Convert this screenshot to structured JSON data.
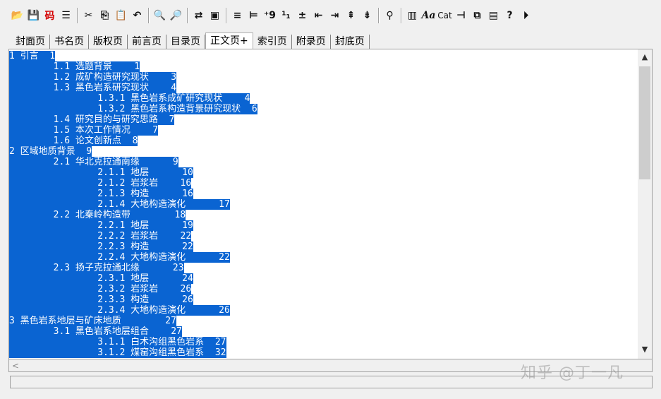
{
  "toolbar": {
    "buttons": [
      {
        "name": "open-icon",
        "glyph": "📂"
      },
      {
        "name": "save-icon",
        "glyph": "💾"
      },
      {
        "name": "code-icon",
        "glyph": "码"
      },
      {
        "name": "outline-icon",
        "glyph": "☰"
      },
      {
        "name": "cut-icon",
        "glyph": "✂"
      },
      {
        "name": "copy-icon",
        "glyph": "⎘"
      },
      {
        "name": "paste-icon",
        "glyph": "📋"
      },
      {
        "name": "undo-icon",
        "glyph": "↶"
      },
      {
        "name": "find-icon",
        "glyph": "🔍"
      },
      {
        "name": "find-next-icon",
        "glyph": "🔎"
      },
      {
        "name": "replace-icon",
        "glyph": "⇄"
      },
      {
        "name": "page-setup-icon",
        "glyph": "▣"
      },
      {
        "name": "align-left-icon",
        "glyph": "≡"
      },
      {
        "name": "indent-icon",
        "glyph": "⊨"
      },
      {
        "name": "number-icon",
        "glyph": "⁺9"
      },
      {
        "name": "multi-level-icon",
        "glyph": "¹₁"
      },
      {
        "name": "plus-minus-icon",
        "glyph": "±"
      },
      {
        "name": "promote-icon",
        "glyph": "⇤"
      },
      {
        "name": "demote-icon",
        "glyph": "⇥"
      },
      {
        "name": "level-up-icon",
        "glyph": "⇞"
      },
      {
        "name": "level-down-icon",
        "glyph": "⇟"
      },
      {
        "name": "pdf-icon",
        "glyph": "⚲"
      },
      {
        "name": "column-icon",
        "glyph": "▥"
      },
      {
        "name": "font-icon",
        "glyph": "Aa"
      },
      {
        "name": "catalog-icon",
        "glyph": "Cat"
      },
      {
        "name": "pin-icon",
        "glyph": "⊣"
      },
      {
        "name": "window-icon",
        "glyph": "⧉"
      },
      {
        "name": "preview-icon",
        "glyph": "▤"
      },
      {
        "name": "help-icon",
        "glyph": "?"
      },
      {
        "name": "exit-icon",
        "glyph": "⏵"
      }
    ]
  },
  "tabs": [
    "封面页",
    "书名页",
    "版权页",
    "前言页",
    "目录页",
    "正文页+",
    "索引页",
    "附录页",
    "封底页"
  ],
  "active_tab": "正文页+",
  "lines": [
    "1 引言  1",
    "        1.1 选题背景    1",
    "        1.2 成矿构造研究现状    3",
    "        1.3 黑色岩系研究现状    4",
    "                1.3.1 黑色岩系成矿研究现状    4",
    "                1.3.2 黑色岩系构造背景研究现状  6",
    "        1.4 研究目的与研究思路  7",
    "        1.5 本次工作情况    7",
    "        1.6 论文创新点  8",
    "2 区域地质背景  9",
    "        2.1 华北克拉通南缘      9",
    "                2.1.1 地层      10",
    "                2.1.2 岩浆岩    16",
    "                2.1.3 构造      16",
    "                2.1.4 大地构造演化      17",
    "        2.2 北秦岭构造带        18",
    "                2.2.1 地层      19",
    "                2.2.2 岩浆岩    22",
    "                2.2.3 构造      22",
    "                2.2.4 大地构造演化      22",
    "        2.3 扬子克拉通北缘      23",
    "                2.3.1 地层      24",
    "                2.3.2 岩浆岩    26",
    "                2.3.3 构造      26",
    "                2.3.4 大地构造演化      26",
    "3 黑色岩系地层与矿床地质        27",
    "        3.1 黑色岩系地层组合    27",
    "                3.1.1 白术沟组黑色岩系  27",
    "                3.1.2 煤窑沟组黑色岩系  32"
  ],
  "scroll": {
    "up": "▲",
    "down": "▼",
    "left": "<"
  },
  "watermark": "知乎 @丁一凡",
  "colors": {
    "selection": "#0a64d2",
    "code": "#d40000"
  }
}
